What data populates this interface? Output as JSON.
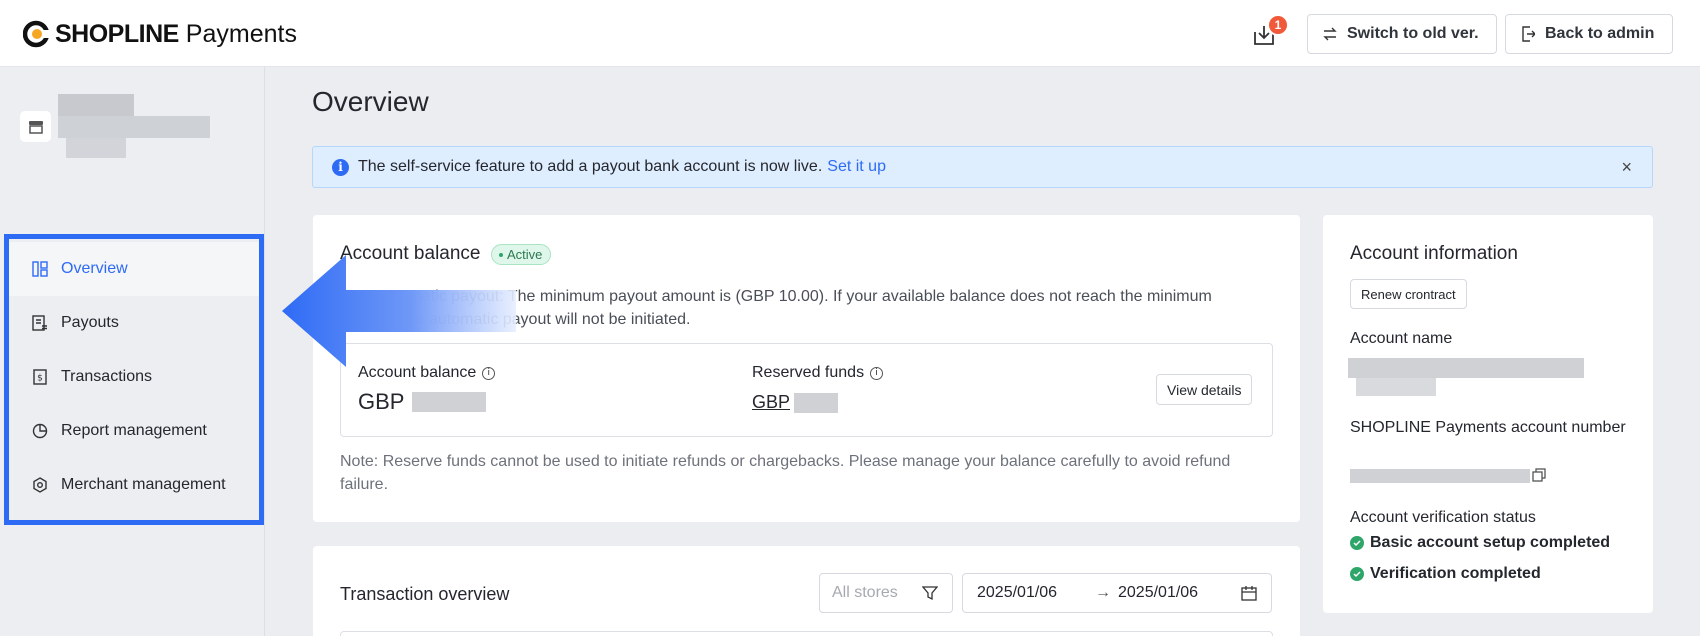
{
  "header": {
    "brand": "SHOPLINE",
    "product": "Payments",
    "download_badge": "1",
    "switch_label": "Switch to old ver.",
    "back_label": "Back to admin"
  },
  "sidebar": {
    "items": [
      {
        "label": "Overview",
        "icon": "dashboard-icon",
        "active": true
      },
      {
        "label": "Payouts",
        "icon": "payout-document-icon"
      },
      {
        "label": "Transactions",
        "icon": "dollar-document-icon"
      },
      {
        "label": "Report management",
        "icon": "pie-chart-icon"
      },
      {
        "label": "Merchant management",
        "icon": "hexagon-settings-icon"
      }
    ]
  },
  "main": {
    "title": "Overview",
    "alert": {
      "text": "The self-service feature to add a payout bank account is now live.",
      "link": "Set it up",
      "close": "×"
    },
    "balance_card": {
      "title": "Account balance",
      "status": "Active",
      "description": "Next automatic payout: The minimum payout amount is (GBP 10.00). If your available balance does not reach the minimum amount, the automatic payout will not be initiated.",
      "account_balance_label": "Account balance",
      "account_balance_currency": "GBP",
      "reserved_label": "Reserved funds",
      "reserved_currency": "GBP",
      "view_details": "View details",
      "note": "Note: Reserve funds cannot be used to initiate refunds or chargebacks. Please manage your balance carefully to avoid refund failure."
    },
    "account_info": {
      "title": "Account information",
      "renew_button": "Renew crontract",
      "account_name_label": "Account name",
      "account_number_label": "SHOPLINE Payments account number",
      "verification_label": "Account verification status",
      "checks": [
        "Basic account setup completed",
        "Verification completed"
      ]
    },
    "transaction_overview": {
      "title": "Transaction overview",
      "stores_placeholder": "All stores",
      "date_from": "2025/01/06",
      "date_separator": "→",
      "date_to": "2025/01/06"
    }
  },
  "colors": {
    "primary": "#2e6bf5",
    "success": "#2ea66a",
    "badge": "#f05a3a",
    "alert_bg": "#dfeeff"
  }
}
